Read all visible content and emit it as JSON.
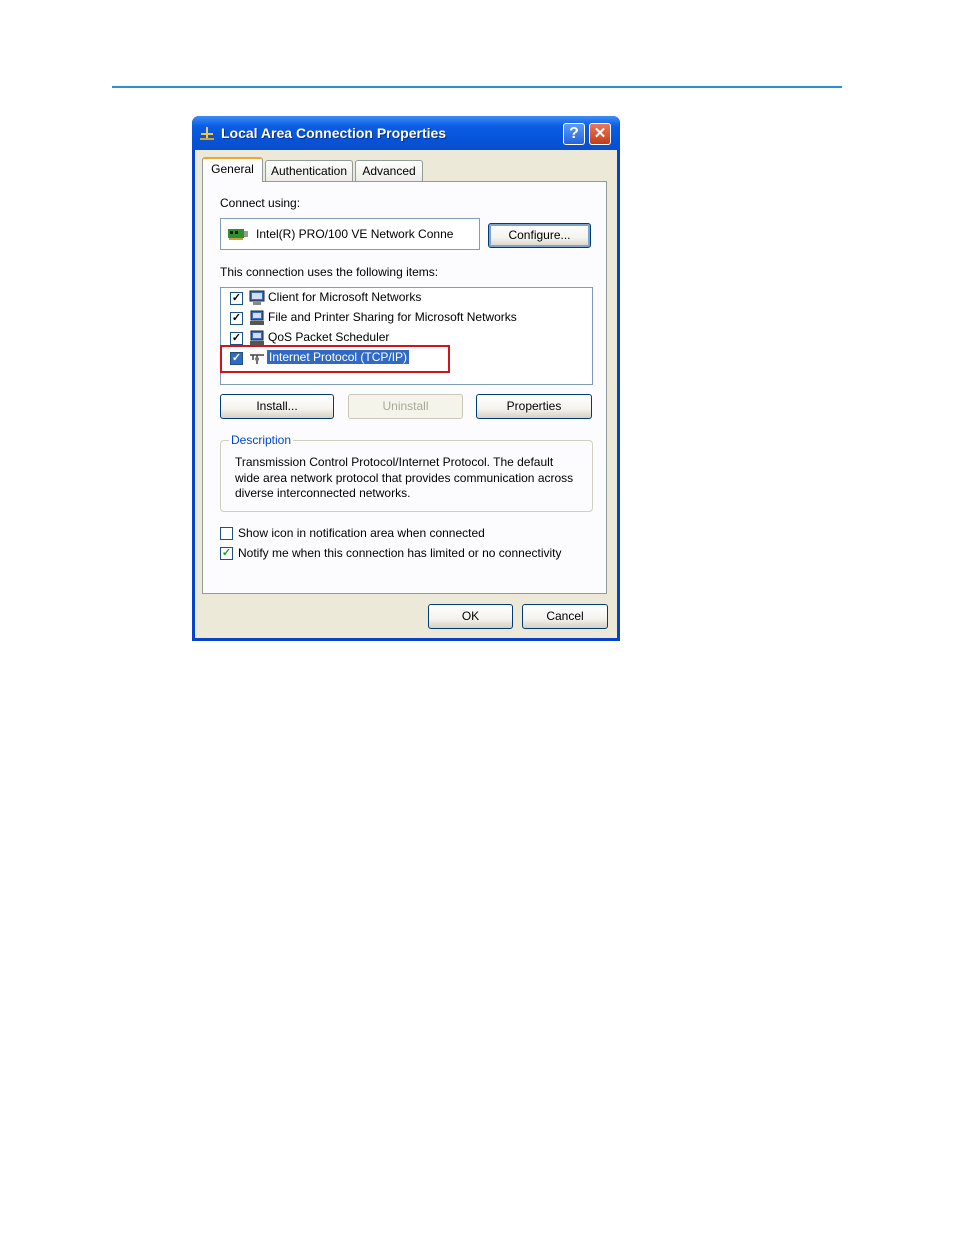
{
  "window": {
    "title": "Local Area Connection Properties",
    "help_label": "?",
    "close_label": "✕"
  },
  "tabs": [
    {
      "label": "General",
      "active": true
    },
    {
      "label": "Authentication",
      "active": false
    },
    {
      "label": "Advanced",
      "active": false
    }
  ],
  "connect": {
    "label": "Connect using:",
    "adapter": "Intel(R) PRO/100 VE Network Conne",
    "configure_label": "Configure..."
  },
  "items_section": {
    "label": "This connection uses the following items:",
    "items": [
      {
        "label": "Client for Microsoft Networks",
        "checked": true,
        "icon": "network-client-icon"
      },
      {
        "label": "File and Printer Sharing for Microsoft Networks",
        "checked": true,
        "icon": "file-printer-sharing-icon"
      },
      {
        "label": "QoS Packet Scheduler",
        "checked": true,
        "icon": "qos-scheduler-icon"
      },
      {
        "label": "Internet Protocol (TCP/IP)",
        "checked": true,
        "selected": true,
        "icon": "protocol-icon"
      }
    ]
  },
  "buttons": {
    "install": "Install...",
    "uninstall": "Uninstall",
    "properties": "Properties",
    "ok": "OK",
    "cancel": "Cancel"
  },
  "description": {
    "legend": "Description",
    "text": "Transmission Control Protocol/Internet Protocol. The default wide area network protocol that provides communication across diverse interconnected networks."
  },
  "options": [
    {
      "label": "Show icon in notification area when connected",
      "checked": false
    },
    {
      "label": "Notify me when this connection has limited or no connectivity",
      "checked": true
    }
  ],
  "colors": {
    "title_bar": "#0653d8",
    "selection": "#316ac5",
    "highlight_box": "#d0141c",
    "page_rule": "#2e8fd0"
  }
}
